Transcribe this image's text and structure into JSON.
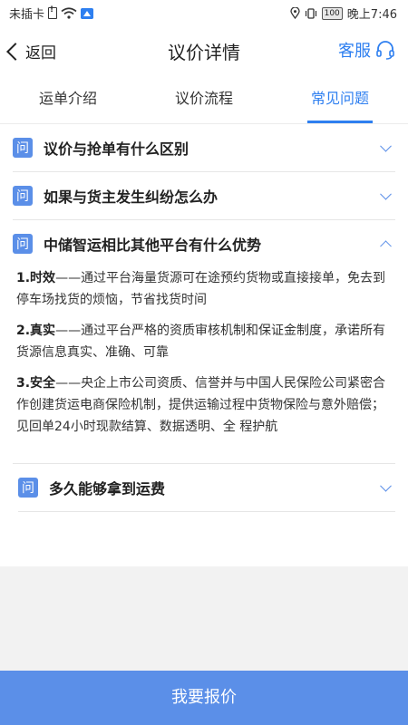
{
  "status_bar": {
    "carrier": "未插卡",
    "battery": "100",
    "time": "晚上7:46"
  },
  "navbar": {
    "back_label": "返回",
    "title": "议价详情",
    "service_label": "客服"
  },
  "tabs": [
    {
      "label": "运单介绍",
      "active": false
    },
    {
      "label": "议价流程",
      "active": false
    },
    {
      "label": "常见问题",
      "active": true
    }
  ],
  "faq": {
    "badge": "问",
    "items": [
      {
        "question": "议价与抢单有什么区别",
        "expanded": false
      },
      {
        "question": "如果与货主发生纠纷怎么办",
        "expanded": false
      },
      {
        "question": "中储智运相比其他平台有什么优势",
        "expanded": true,
        "answer": [
          {
            "term": "1.时效",
            "text": "——通过平台海量货源可在途预约货物或直接接单，免去到停车场找货的烦恼，节省找货时间"
          },
          {
            "term": "2.真实",
            "text": "——通过平台严格的资质审核机制和保证金制度，承诺所有货源信息真实、准确、可靠"
          },
          {
            "term": "3.安全",
            "text": "——央企上市公司资质、信誉并与中国人民保险公司紧密合作创建货运电商保险机制，提供运输过程中货物保险与意外赔偿；见回单24小时现款结算、数据透明、全 程护航"
          }
        ]
      },
      {
        "question": "多久能够拿到运费",
        "expanded": false
      }
    ]
  },
  "footer": {
    "quote_button": "我要报价"
  },
  "colors": {
    "accent": "#2e7ff0",
    "badge": "#5b8fe8",
    "button": "#5b8fe8"
  }
}
